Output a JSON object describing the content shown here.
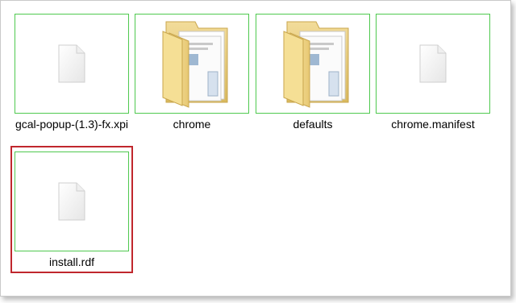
{
  "files": [
    {
      "name": "gcal-popup-(1.3)-fx.xpi",
      "icon": "file-icon"
    },
    {
      "name": "chrome",
      "icon": "folder-icon"
    },
    {
      "name": "defaults",
      "icon": "folder-icon"
    },
    {
      "name": "chrome.manifest",
      "icon": "file-icon"
    },
    {
      "name": "install.rdf",
      "icon": "file-icon"
    }
  ],
  "colors": {
    "thumb_border": "#4fc94f",
    "selection_border": "#c0272d"
  }
}
